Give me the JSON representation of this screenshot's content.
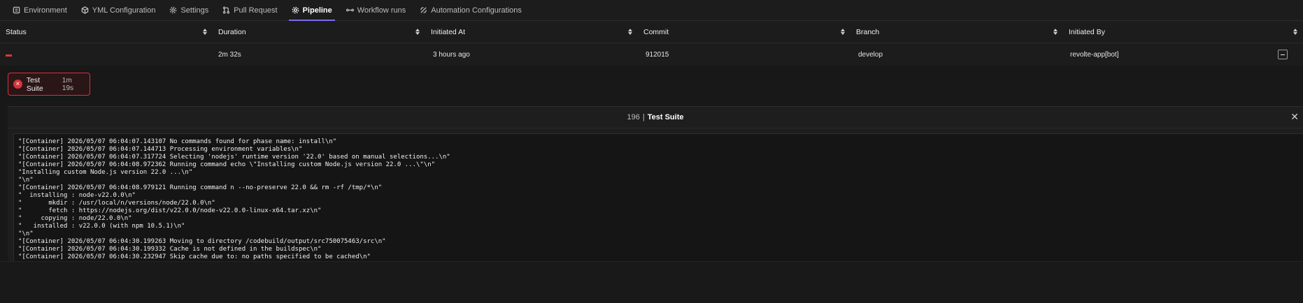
{
  "tabs": [
    {
      "label": "Environment",
      "icon": "environment-icon"
    },
    {
      "label": "YML Configuration",
      "icon": "cube-icon"
    },
    {
      "label": "Settings",
      "icon": "gear-icon"
    },
    {
      "label": "Pull Request",
      "icon": "pull-request-icon"
    },
    {
      "label": "Pipeline",
      "icon": "pipeline-icon",
      "active": true
    },
    {
      "label": "Workflow runs",
      "icon": "workflow-icon"
    },
    {
      "label": "Automation Configurations",
      "icon": "automation-icon"
    }
  ],
  "table": {
    "columns": [
      "Status",
      "Duration",
      "Initiated At",
      "Commit",
      "Branch",
      "Initiated By"
    ],
    "row": {
      "status": "failed",
      "duration": "2m 32s",
      "initiated_at": "3 hours ago",
      "commit": "912015",
      "branch": "develop",
      "initiated_by": "revolte-app[bot]"
    }
  },
  "suite": {
    "name": "Test Suite",
    "time": "1m 19s"
  },
  "panel": {
    "number": "196",
    "separator": "|",
    "title": "Test Suite"
  },
  "log": [
    "\"[Container] 2026/05/07 06:04:07.143107 No commands found for phase name: install\\n\"",
    "\"[Container] 2026/05/07 06:04:07.144713 Processing environment variables\\n\"",
    "\"[Container] 2026/05/07 06:04:07.317724 Selecting 'nodejs' runtime version '22.0' based on manual selections...\\n\"",
    "\"[Container] 2026/05/07 06:04:08.972362 Running command echo \\\"Installing custom Node.js version 22.0 ...\\\"\\n\"",
    "\"Installing custom Node.js version 22.0 ...\\n\"",
    "\"\\n\"",
    "\"[Container] 2026/05/07 06:04:08.979121 Running command n --no-preserve 22.0 && rm -rf /tmp/*\\n\"",
    "\"  installing : node-v22.0.0\\n\"",
    "\"       mkdir : /usr/local/n/versions/node/22.0.0\\n\"",
    "\"       fetch : https://nodejs.org/dist/v22.0.0/node-v22.0.0-linux-x64.tar.xz\\n\"",
    "\"     copying : node/22.0.0\\n\"",
    "\"   installed : v22.0.0 (with npm 10.5.1)\\n\"",
    "\"\\n\"",
    "\"[Container] 2026/05/07 06:04:30.199263 Moving to directory /codebuild/output/src750075463/src\\n\"",
    "\"[Container] 2026/05/07 06:04:30.199332 Cache is not defined in the buildspec\\n\"",
    "\"[Container] 2026/05/07 06:04:30.232947 Skip cache due to: no paths specified to be cached\\n\""
  ],
  "colors": {
    "accent": "#7c6cf0",
    "error": "#d8323a",
    "background": "#181818"
  }
}
